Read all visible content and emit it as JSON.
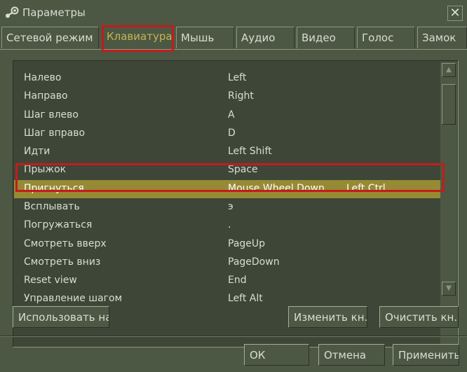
{
  "window": {
    "title": "Параметры",
    "close_label": "✕"
  },
  "tabs": [
    {
      "label": "Сетевой режим",
      "active": false
    },
    {
      "label": "Клавиатура",
      "active": true
    },
    {
      "label": "Мышь",
      "active": false
    },
    {
      "label": "Аудио",
      "active": false
    },
    {
      "label": "Видео",
      "active": false
    },
    {
      "label": "Голос",
      "active": false
    },
    {
      "label": "Замок",
      "active": false
    }
  ],
  "bindings": [
    {
      "action": "Налево",
      "key": "Left",
      "alt": ""
    },
    {
      "action": "Направо",
      "key": "Right",
      "alt": ""
    },
    {
      "action": "Шаг влево",
      "key": "A",
      "alt": ""
    },
    {
      "action": "Шаг вправо",
      "key": "D",
      "alt": ""
    },
    {
      "action": "Идти",
      "key": "Left Shift",
      "alt": ""
    },
    {
      "action": "Прыжок",
      "key": "Space",
      "alt": ""
    },
    {
      "action": "Пригнуться",
      "key": "Mouse Wheel Down",
      "alt": "Left Ctrl",
      "selected": true
    },
    {
      "action": "Всплывать",
      "key": "э",
      "alt": ""
    },
    {
      "action": "Погружаться",
      "key": ".",
      "alt": ""
    },
    {
      "action": "Смотреть вверх",
      "key": "PageUp",
      "alt": ""
    },
    {
      "action": "Смотреть вниз",
      "key": "PageDown",
      "alt": ""
    },
    {
      "action": "Reset view",
      "key": "End",
      "alt": ""
    },
    {
      "action": "Управление шагом",
      "key": "Left Alt",
      "alt": ""
    }
  ],
  "scrollbar": {
    "up_icon": "▲",
    "down_icon": "▼"
  },
  "buttons": {
    "use_defaults": "Использовать на..",
    "change_key": "Изменить кн..",
    "clear_key": "Очистить кн..",
    "ok": "ОК",
    "cancel": "Отмена",
    "apply": "Применить"
  },
  "colors": {
    "background": "#4c5844",
    "list_background": "#3e4637",
    "selection": "#968a34",
    "active_tab_text": "#c4b550",
    "highlight_box": "#c31c1c"
  }
}
